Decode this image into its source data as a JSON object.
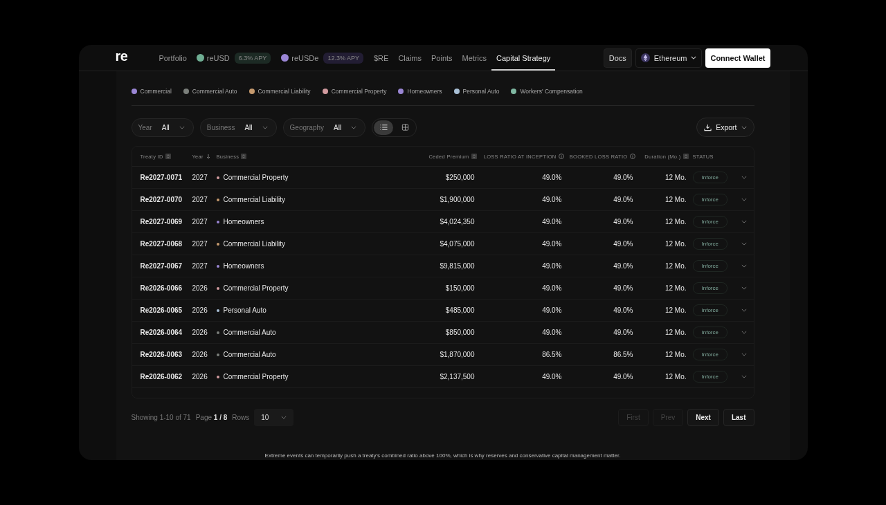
{
  "header": {
    "logo": "re",
    "nav": [
      {
        "label": "Portfolio",
        "selected": false
      },
      {
        "label": "reUSD",
        "selected": false,
        "badge": "6.3% APY"
      },
      {
        "label": "reUSDe",
        "selected": false,
        "badge": "12.3% APY"
      },
      {
        "label": "$RE",
        "selected": false
      },
      {
        "label": "Claims",
        "selected": false
      },
      {
        "label": "Points",
        "selected": false
      },
      {
        "label": "Metrics",
        "selected": false
      },
      {
        "label": "Capital Strategy",
        "selected": true
      }
    ],
    "docs": "Docs",
    "network": "Ethereum",
    "connect": "Connect Wallet"
  },
  "legend": [
    {
      "label": "Commercial",
      "color": "#9a86d4"
    },
    {
      "label": "Commercial Auto",
      "color": "#7b7f7b"
    },
    {
      "label": "Commercial Liability",
      "color": "#c69a6e"
    },
    {
      "label": "Commercial Property",
      "color": "#d29b9f"
    },
    {
      "label": "Homeowners",
      "color": "#9a86d4"
    },
    {
      "label": "Personal Auto",
      "color": "#a9c0d6"
    },
    {
      "label": "Workers' Compensation",
      "color": "#7fb8a2"
    }
  ],
  "filters": [
    {
      "label": "Year",
      "value": "All"
    },
    {
      "label": "Business",
      "value": "All"
    },
    {
      "label": "Geography",
      "value": "All"
    }
  ],
  "views": [
    {
      "kind": "list",
      "selected": true
    },
    {
      "kind": "grid",
      "selected": false
    }
  ],
  "export": "Export",
  "table": {
    "columns": [
      "Treaty ID",
      "Year",
      "Business",
      "Ceded Premium",
      "LOSS RATIO AT INCEPTION",
      "BOOKED LOSS RATIO",
      "Duration (Mo.)",
      "STATUS"
    ],
    "rows": [
      {
        "id": "Re2027-0071",
        "year": "2027",
        "business": "Commercial Property",
        "color": "#d29b9f",
        "premium": "$250,000",
        "inception": "49.0%",
        "booked": "49.0%",
        "duration": "12 Mo.",
        "status": "Inforce"
      },
      {
        "id": "Re2027-0070",
        "year": "2027",
        "business": "Commercial Liability",
        "color": "#c69a6e",
        "premium": "$1,900,000",
        "inception": "49.0%",
        "booked": "49.0%",
        "duration": "12 Mo.",
        "status": "Inforce"
      },
      {
        "id": "Re2027-0069",
        "year": "2027",
        "business": "Homeowners",
        "color": "#9a86d4",
        "premium": "$4,024,350",
        "inception": "49.0%",
        "booked": "49.0%",
        "duration": "12 Mo.",
        "status": "Inforce"
      },
      {
        "id": "Re2027-0068",
        "year": "2027",
        "business": "Commercial Liability",
        "color": "#c69a6e",
        "premium": "$4,075,000",
        "inception": "49.0%",
        "booked": "49.0%",
        "duration": "12 Mo.",
        "status": "Inforce"
      },
      {
        "id": "Re2027-0067",
        "year": "2027",
        "business": "Homeowners",
        "color": "#9a86d4",
        "premium": "$9,815,000",
        "inception": "49.0%",
        "booked": "49.0%",
        "duration": "12 Mo.",
        "status": "Inforce"
      },
      {
        "id": "Re2026-0066",
        "year": "2026",
        "business": "Commercial Property",
        "color": "#d29b9f",
        "premium": "$150,000",
        "inception": "49.0%",
        "booked": "49.0%",
        "duration": "12 Mo.",
        "status": "Inforce"
      },
      {
        "id": "Re2026-0065",
        "year": "2026",
        "business": "Personal Auto",
        "color": "#a9c0d6",
        "premium": "$485,000",
        "inception": "49.0%",
        "booked": "49.0%",
        "duration": "12 Mo.",
        "status": "Inforce"
      },
      {
        "id": "Re2026-0064",
        "year": "2026",
        "business": "Commercial Auto",
        "color": "#7b7f7b",
        "premium": "$850,000",
        "inception": "49.0%",
        "booked": "49.0%",
        "duration": "12 Mo.",
        "status": "Inforce"
      },
      {
        "id": "Re2026-0063",
        "year": "2026",
        "business": "Commercial Auto",
        "color": "#7b7f7b",
        "premium": "$1,870,000",
        "inception": "86.5%",
        "booked": "86.5%",
        "duration": "12 Mo.",
        "status": "Inforce"
      },
      {
        "id": "Re2026-0062",
        "year": "2026",
        "business": "Commercial Property",
        "color": "#d29b9f",
        "premium": "$2,137,500",
        "inception": "49.0%",
        "booked": "49.0%",
        "duration": "12 Mo.",
        "status": "Inforce"
      }
    ]
  },
  "pagination": {
    "showing": "Showing 1-10 of 71",
    "page": "Page **1 / 8**",
    "rows_label": "Rows",
    "rows_value": "10",
    "buttons": [
      {
        "label": "First",
        "disabled": true
      },
      {
        "label": "Prev",
        "disabled": true
      },
      {
        "label": "Next",
        "disabled": false
      },
      {
        "label": "Last",
        "disabled": false
      }
    ]
  },
  "footnote": "Extreme events can temporarily push a treaty's combined ratio above 100%, which is why reserves and conservative capital management matter."
}
